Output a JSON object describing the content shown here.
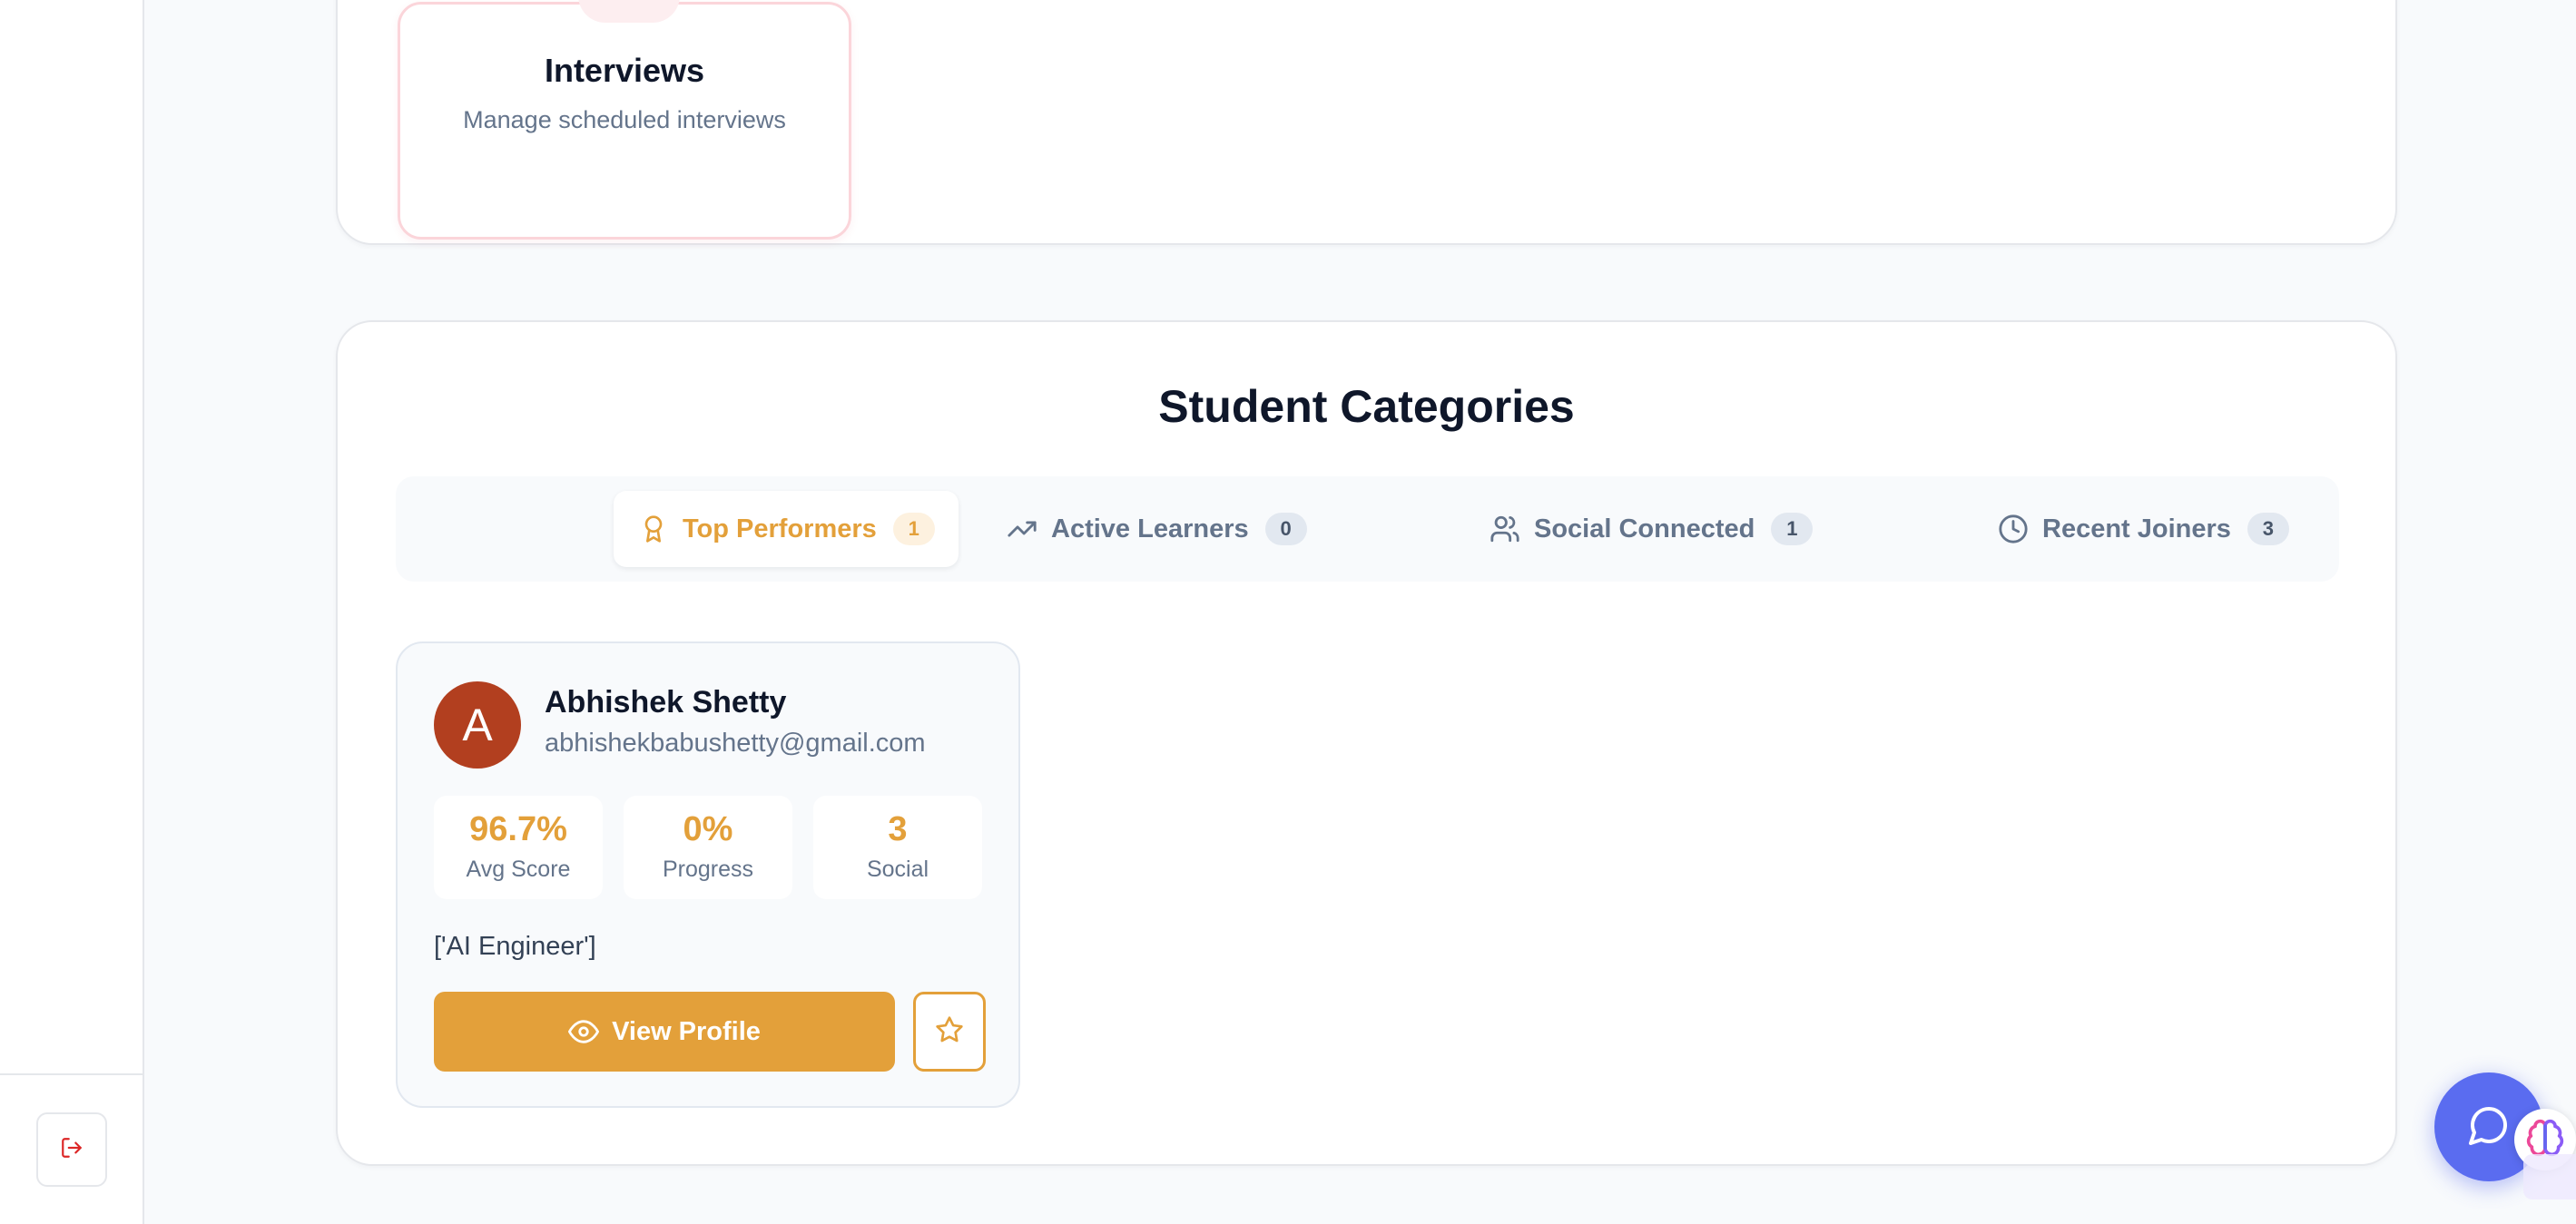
{
  "sidebar": {
    "logout_icon": "log-out-icon"
  },
  "interviews_card": {
    "title": "Interviews",
    "subtitle": "Manage scheduled interviews",
    "accent_color": "#fbd5da"
  },
  "categories": {
    "title": "Student Categories",
    "tabs": [
      {
        "label": "Top Performers",
        "count": "1",
        "icon": "award-icon",
        "active": true
      },
      {
        "label": "Active Learners",
        "count": "0",
        "icon": "trending-up-icon",
        "active": false
      },
      {
        "label": "Social Connected",
        "count": "1",
        "icon": "users-icon",
        "active": false
      },
      {
        "label": "Recent Joiners",
        "count": "3",
        "icon": "clock-icon",
        "active": false
      }
    ],
    "accent_color": "#e3a03a"
  },
  "student": {
    "avatar_initial": "A",
    "avatar_color": "#b23f1f",
    "name": "Abhishek Shetty",
    "email": "abhishekbabushetty@gmail.com",
    "stats": [
      {
        "value": "96.7%",
        "label": "Avg Score"
      },
      {
        "value": "0%",
        "label": "Progress"
      },
      {
        "value": "3",
        "label": "Social"
      }
    ],
    "roles": "['AI Engineer']",
    "view_profile_label": "View Profile",
    "favorite_icon": "star-icon"
  },
  "chat": {
    "chat_icon": "message-circle-icon",
    "brain_icon": "brain-icon",
    "fab_color": "#5a6cf0"
  }
}
